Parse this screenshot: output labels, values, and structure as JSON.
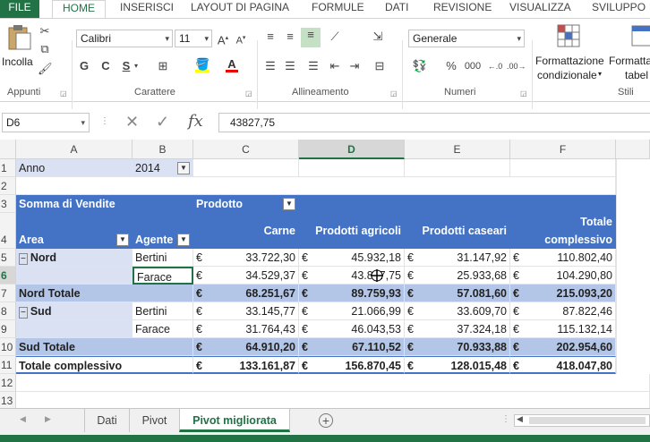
{
  "tabs": [
    "FILE",
    "HOME",
    "INSERISCI",
    "LAYOUT DI PAGINA",
    "FORMULE",
    "DATI",
    "REVISIONE",
    "VISUALIZZA",
    "SVILUPPO"
  ],
  "ribbon": {
    "paste_label": "Incolla",
    "font_name": "Calibri",
    "font_size": "11",
    "bold": "G",
    "italic": "C",
    "underline": "S",
    "number_format": "Generale",
    "cond_format_l1": "Formattazione",
    "cond_format_l2": "condizionale",
    "table_format_l1": "Formatta",
    "table_format_l2": "tabel",
    "groups": {
      "appunti": "Appunti",
      "carattere": "Carattere",
      "allineamento": "Allineamento",
      "numeri": "Numeri",
      "stili": "Stili"
    }
  },
  "formula_bar": {
    "name_box": "D6",
    "formula": "43827,75"
  },
  "columns": [
    "A",
    "B",
    "C",
    "D",
    "E",
    "F"
  ],
  "rows": [
    "1",
    "2",
    "3",
    "4",
    "5",
    "6",
    "7",
    "8",
    "9",
    "10",
    "11",
    "12",
    "13"
  ],
  "sheet": {
    "r1": {
      "a": "Anno",
      "b": "2014"
    },
    "r3": {
      "a": "Somma di Vendite",
      "c": "Prodotto"
    },
    "r4": {
      "a": "Area",
      "b": "Agente",
      "c": "Carne",
      "d": "Prodotti agricoli",
      "e": "Prodotti caseari",
      "f1": "Totale",
      "f2": "complessivo"
    },
    "r5": {
      "a": "Nord",
      "b": "Bertini",
      "c": "33.722,30",
      "d": "45.932,18",
      "e": "31.147,92",
      "f": "110.802,40"
    },
    "r6": {
      "b": "Farace",
      "c": "34.529,37",
      "d": "43.827,75",
      "e": "25.933,68",
      "f": "104.290,80"
    },
    "r7": {
      "a": "Nord Totale",
      "c": "68.251,67",
      "d": "89.759,93",
      "e": "57.081,60",
      "f": "215.093,20"
    },
    "r8": {
      "a": "Sud",
      "b": "Bertini",
      "c": "33.145,77",
      "d": "21.066,99",
      "e": "33.609,70",
      "f": "87.822,46"
    },
    "r9": {
      "b": "Farace",
      "c": "31.764,43",
      "d": "46.043,53",
      "e": "37.324,18",
      "f": "115.132,14"
    },
    "r10": {
      "a": "Sud Totale",
      "c": "64.910,20",
      "d": "67.110,52",
      "e": "70.933,88",
      "f": "202.954,60"
    },
    "r11": {
      "a": "Totale complessivo",
      "c": "133.161,87",
      "d": "156.870,45",
      "e": "128.015,48",
      "f": "418.047,80"
    },
    "currency": "€"
  },
  "sheet_tabs": [
    "Dati",
    "Pivot",
    "Pivot migliorata"
  ],
  "colors": {
    "accent": "#217346",
    "pivot_header": "#4472c4",
    "pivot_light": "#d9e1f2",
    "pivot_medium": "#b4c6e7"
  }
}
